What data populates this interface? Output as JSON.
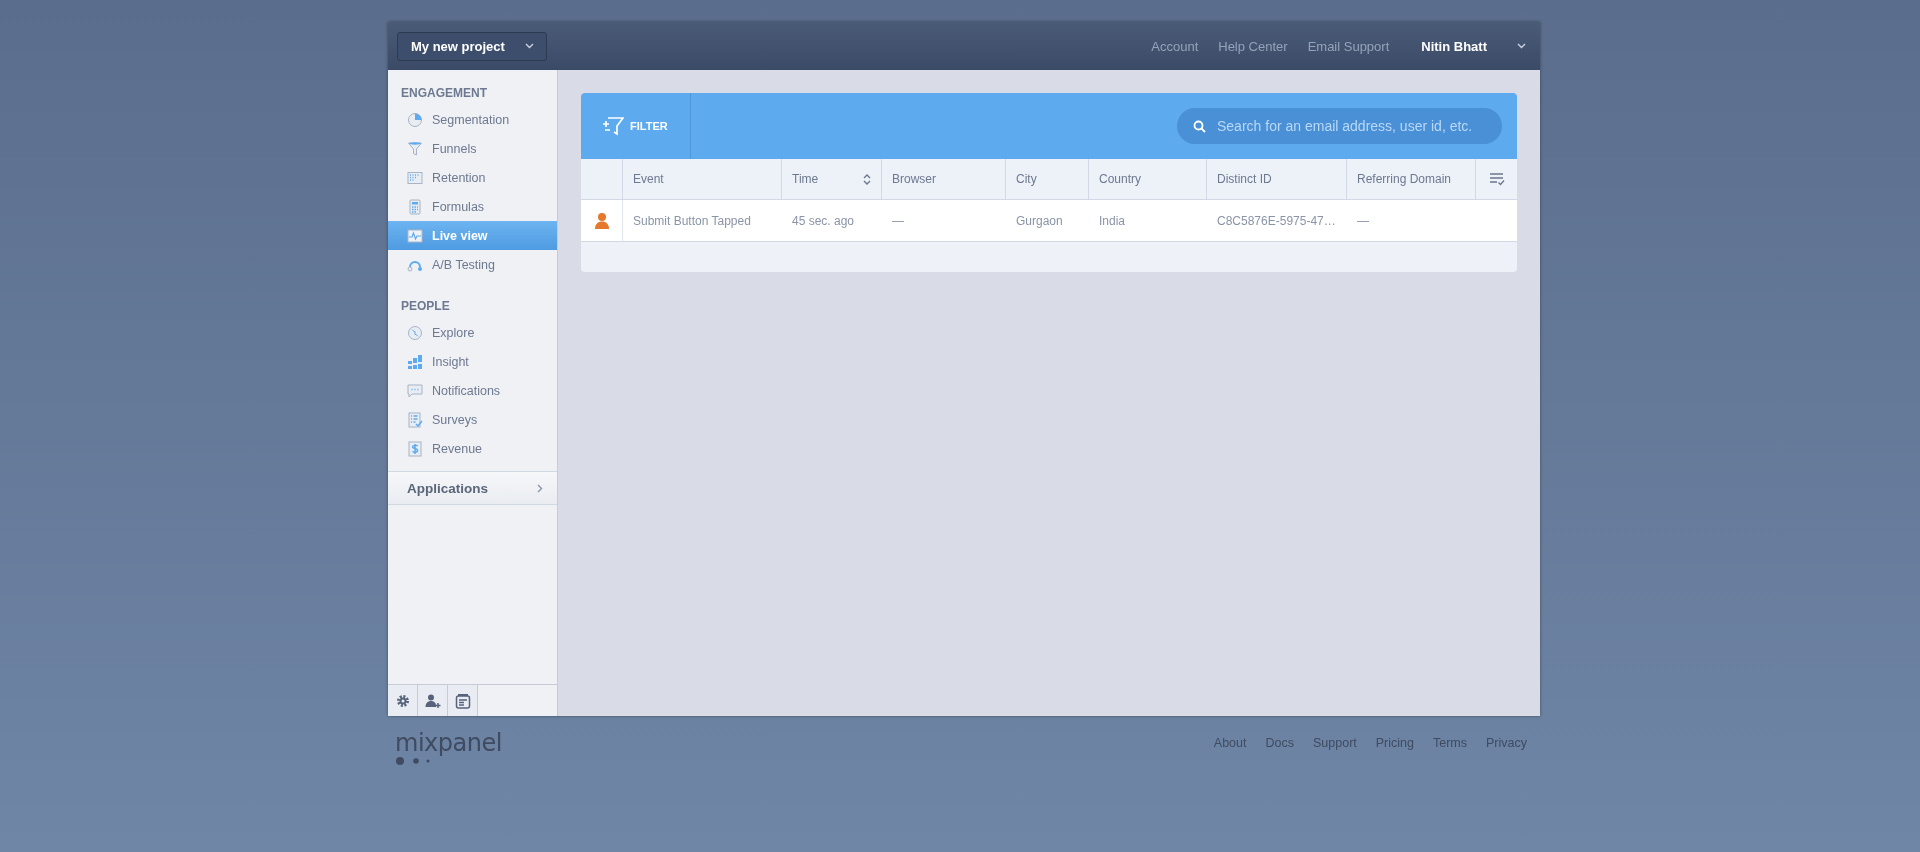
{
  "topbar": {
    "project": "My new project",
    "links": [
      "Account",
      "Help Center",
      "Email Support"
    ],
    "user": "Nitin Bhatt"
  },
  "sidebar": {
    "sections": [
      {
        "heading": "ENGAGEMENT",
        "items": [
          {
            "label": "Segmentation",
            "selected": false
          },
          {
            "label": "Funnels",
            "selected": false
          },
          {
            "label": "Retention",
            "selected": false
          },
          {
            "label": "Formulas",
            "selected": false
          },
          {
            "label": "Live view",
            "selected": true
          },
          {
            "label": "A/B Testing",
            "selected": false
          }
        ]
      },
      {
        "heading": "PEOPLE",
        "items": [
          {
            "label": "Explore",
            "selected": false
          },
          {
            "label": "Insight",
            "selected": false
          },
          {
            "label": "Notifications",
            "selected": false
          },
          {
            "label": "Surveys",
            "selected": false
          },
          {
            "label": "Revenue",
            "selected": false
          }
        ]
      }
    ],
    "applications": "Applications"
  },
  "panel": {
    "filter": "FILTER",
    "search": {
      "placeholder": "Search for an email address, user id, etc."
    },
    "columns": [
      {
        "label": "Event",
        "sortable": false
      },
      {
        "label": "Time",
        "sortable": true
      },
      {
        "label": "Browser",
        "sortable": false
      },
      {
        "label": "City",
        "sortable": false
      },
      {
        "label": "Country",
        "sortable": false
      },
      {
        "label": "Distinct ID",
        "sortable": false
      },
      {
        "label": "Referring Domain",
        "sortable": false
      }
    ],
    "rows": [
      {
        "cells": [
          "Submit Button Tapped",
          "45 sec. ago",
          "—",
          "Gurgaon",
          "India",
          "C8C5876E-5975-47…",
          "—"
        ]
      }
    ]
  },
  "footer": {
    "logo": "mixpanel",
    "links": [
      "About",
      "Docs",
      "Support",
      "Pricing",
      "Terms",
      "Privacy"
    ]
  }
}
